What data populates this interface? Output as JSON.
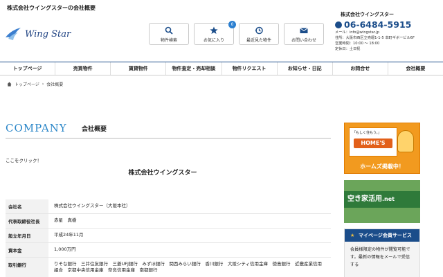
{
  "top_title": "株式会社ウイングスターの会社概要",
  "logo": {
    "text": "Wing Star"
  },
  "quick_links": [
    {
      "label": "物件検索",
      "icon": "search-icon"
    },
    {
      "label": "お気に入り",
      "icon": "star-icon",
      "badge": "0"
    },
    {
      "label": "最近見た物件",
      "icon": "history-icon"
    },
    {
      "label": "お問い合わせ",
      "icon": "mail-icon"
    }
  ],
  "company_info": {
    "name": "株式会社ウイングスター",
    "phone": "06-6484-5915",
    "lines": [
      "メール：info@wingstar.jp",
      "住所：大阪市西区立売堀1-1-5 本町ギボービル6F",
      "営業時間：10:00 ～ 18:00",
      "定休日：土日祝"
    ]
  },
  "nav": [
    "トップページ",
    "売買物件",
    "賃貸物件",
    "物件査定・売却相談",
    "物件リクエスト",
    "お知らせ・日記",
    "お問合せ",
    "会社概要"
  ],
  "breadcrumb": {
    "home": "トップページ",
    "sep": "›",
    "current": "会社概要"
  },
  "heading": {
    "en": "COMPANY",
    "jp": "会社概要"
  },
  "click_text": "ここをクリック！",
  "company_name": "株式会社ウイングスター",
  "table": [
    {
      "th": "会社名",
      "td": "株式会社ウイングスター（大阪本社）"
    },
    {
      "th": "代表取締役社長",
      "td": "赤星　真樹"
    },
    {
      "th": "設立年月日",
      "td": "平成24年11月"
    },
    {
      "th": "資本金",
      "td": "1,000万円"
    },
    {
      "th": "取引銀行",
      "td": "りそな銀行　三井住友銀行　三菱UFJ銀行　みずほ銀行　関西みらい銀行　香川銀行　大阪シティ信用金庫　徳島銀行　近畿産業信用組合　京都中央信用金庫　奈良信用金庫　南都銀行"
    }
  ],
  "ads": {
    "homes_tag": "「もしく住もう。」",
    "homes_logo": "HOME'S",
    "homes_caption": "ホームズ掲載中！",
    "akiya_text": "空き家活用",
    "akiya_suffix": ".net"
  },
  "mypage": {
    "title": "マイページ会員サービス",
    "text": "会員様限定の物件が閲覧可能です。最新の情報をメールで受信する"
  }
}
